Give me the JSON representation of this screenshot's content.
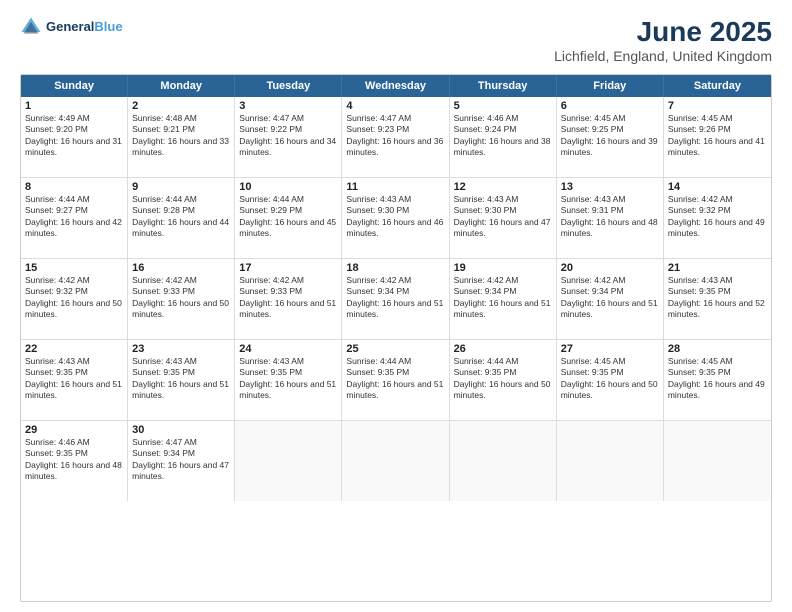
{
  "header": {
    "logo": {
      "line1": "General",
      "line2": "Blue"
    },
    "title": "June 2025",
    "subtitle": "Lichfield, England, United Kingdom"
  },
  "calendar": {
    "days_of_week": [
      "Sunday",
      "Monday",
      "Tuesday",
      "Wednesday",
      "Thursday",
      "Friday",
      "Saturday"
    ],
    "weeks": [
      [
        {
          "day": "",
          "sunrise": "",
          "sunset": "",
          "daylight": "",
          "empty": true
        },
        {
          "day": "2",
          "sunrise": "Sunrise: 4:48 AM",
          "sunset": "Sunset: 9:21 PM",
          "daylight": "Daylight: 16 hours and 33 minutes."
        },
        {
          "day": "3",
          "sunrise": "Sunrise: 4:47 AM",
          "sunset": "Sunset: 9:22 PM",
          "daylight": "Daylight: 16 hours and 34 minutes."
        },
        {
          "day": "4",
          "sunrise": "Sunrise: 4:47 AM",
          "sunset": "Sunset: 9:23 PM",
          "daylight": "Daylight: 16 hours and 36 minutes."
        },
        {
          "day": "5",
          "sunrise": "Sunrise: 4:46 AM",
          "sunset": "Sunset: 9:24 PM",
          "daylight": "Daylight: 16 hours and 38 minutes."
        },
        {
          "day": "6",
          "sunrise": "Sunrise: 4:45 AM",
          "sunset": "Sunset: 9:25 PM",
          "daylight": "Daylight: 16 hours and 39 minutes."
        },
        {
          "day": "7",
          "sunrise": "Sunrise: 4:45 AM",
          "sunset": "Sunset: 9:26 PM",
          "daylight": "Daylight: 16 hours and 41 minutes."
        }
      ],
      [
        {
          "day": "8",
          "sunrise": "Sunrise: 4:44 AM",
          "sunset": "Sunset: 9:27 PM",
          "daylight": "Daylight: 16 hours and 42 minutes."
        },
        {
          "day": "9",
          "sunrise": "Sunrise: 4:44 AM",
          "sunset": "Sunset: 9:28 PM",
          "daylight": "Daylight: 16 hours and 44 minutes."
        },
        {
          "day": "10",
          "sunrise": "Sunrise: 4:44 AM",
          "sunset": "Sunset: 9:29 PM",
          "daylight": "Daylight: 16 hours and 45 minutes."
        },
        {
          "day": "11",
          "sunrise": "Sunrise: 4:43 AM",
          "sunset": "Sunset: 9:30 PM",
          "daylight": "Daylight: 16 hours and 46 minutes."
        },
        {
          "day": "12",
          "sunrise": "Sunrise: 4:43 AM",
          "sunset": "Sunset: 9:30 PM",
          "daylight": "Daylight: 16 hours and 47 minutes."
        },
        {
          "day": "13",
          "sunrise": "Sunrise: 4:43 AM",
          "sunset": "Sunset: 9:31 PM",
          "daylight": "Daylight: 16 hours and 48 minutes."
        },
        {
          "day": "14",
          "sunrise": "Sunrise: 4:42 AM",
          "sunset": "Sunset: 9:32 PM",
          "daylight": "Daylight: 16 hours and 49 minutes."
        }
      ],
      [
        {
          "day": "15",
          "sunrise": "Sunrise: 4:42 AM",
          "sunset": "Sunset: 9:32 PM",
          "daylight": "Daylight: 16 hours and 50 minutes."
        },
        {
          "day": "16",
          "sunrise": "Sunrise: 4:42 AM",
          "sunset": "Sunset: 9:33 PM",
          "daylight": "Daylight: 16 hours and 50 minutes."
        },
        {
          "day": "17",
          "sunrise": "Sunrise: 4:42 AM",
          "sunset": "Sunset: 9:33 PM",
          "daylight": "Daylight: 16 hours and 51 minutes."
        },
        {
          "day": "18",
          "sunrise": "Sunrise: 4:42 AM",
          "sunset": "Sunset: 9:34 PM",
          "daylight": "Daylight: 16 hours and 51 minutes."
        },
        {
          "day": "19",
          "sunrise": "Sunrise: 4:42 AM",
          "sunset": "Sunset: 9:34 PM",
          "daylight": "Daylight: 16 hours and 51 minutes."
        },
        {
          "day": "20",
          "sunrise": "Sunrise: 4:42 AM",
          "sunset": "Sunset: 9:34 PM",
          "daylight": "Daylight: 16 hours and 51 minutes."
        },
        {
          "day": "21",
          "sunrise": "Sunrise: 4:43 AM",
          "sunset": "Sunset: 9:35 PM",
          "daylight": "Daylight: 16 hours and 52 minutes."
        }
      ],
      [
        {
          "day": "22",
          "sunrise": "Sunrise: 4:43 AM",
          "sunset": "Sunset: 9:35 PM",
          "daylight": "Daylight: 16 hours and 51 minutes."
        },
        {
          "day": "23",
          "sunrise": "Sunrise: 4:43 AM",
          "sunset": "Sunset: 9:35 PM",
          "daylight": "Daylight: 16 hours and 51 minutes."
        },
        {
          "day": "24",
          "sunrise": "Sunrise: 4:43 AM",
          "sunset": "Sunset: 9:35 PM",
          "daylight": "Daylight: 16 hours and 51 minutes."
        },
        {
          "day": "25",
          "sunrise": "Sunrise: 4:44 AM",
          "sunset": "Sunset: 9:35 PM",
          "daylight": "Daylight: 16 hours and 51 minutes."
        },
        {
          "day": "26",
          "sunrise": "Sunrise: 4:44 AM",
          "sunset": "Sunset: 9:35 PM",
          "daylight": "Daylight: 16 hours and 50 minutes."
        },
        {
          "day": "27",
          "sunrise": "Sunrise: 4:45 AM",
          "sunset": "Sunset: 9:35 PM",
          "daylight": "Daylight: 16 hours and 50 minutes."
        },
        {
          "day": "28",
          "sunrise": "Sunrise: 4:45 AM",
          "sunset": "Sunset: 9:35 PM",
          "daylight": "Daylight: 16 hours and 49 minutes."
        }
      ],
      [
        {
          "day": "29",
          "sunrise": "Sunrise: 4:46 AM",
          "sunset": "Sunset: 9:35 PM",
          "daylight": "Daylight: 16 hours and 48 minutes."
        },
        {
          "day": "30",
          "sunrise": "Sunrise: 4:47 AM",
          "sunset": "Sunset: 9:34 PM",
          "daylight": "Daylight: 16 hours and 47 minutes."
        },
        {
          "day": "",
          "sunrise": "",
          "sunset": "",
          "daylight": "",
          "empty": true
        },
        {
          "day": "",
          "sunrise": "",
          "sunset": "",
          "daylight": "",
          "empty": true
        },
        {
          "day": "",
          "sunrise": "",
          "sunset": "",
          "daylight": "",
          "empty": true
        },
        {
          "day": "",
          "sunrise": "",
          "sunset": "",
          "daylight": "",
          "empty": true
        },
        {
          "day": "",
          "sunrise": "",
          "sunset": "",
          "daylight": "",
          "empty": true
        }
      ]
    ],
    "week0_day1": {
      "day": "1",
      "sunrise": "Sunrise: 4:49 AM",
      "sunset": "Sunset: 9:20 PM",
      "daylight": "Daylight: 16 hours and 31 minutes."
    }
  }
}
